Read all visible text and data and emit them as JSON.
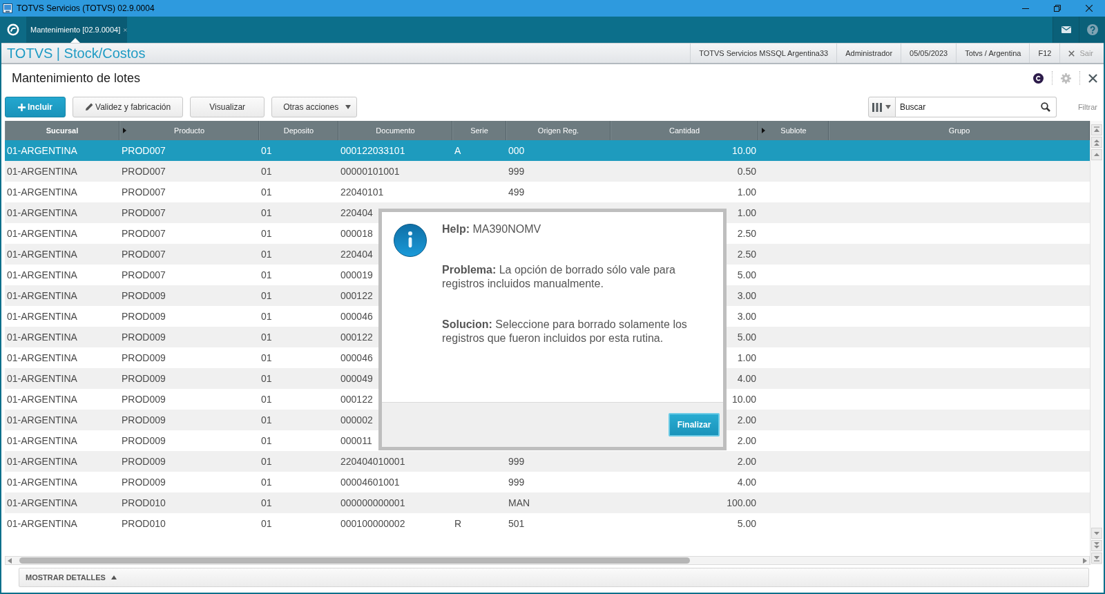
{
  "window": {
    "title": "TOTVS Servicios (TOTVS) 02.9.0004"
  },
  "tabs": [
    {
      "label": "Mantenimiento [02.9.0004]",
      "selected": true
    }
  ],
  "header": {
    "module": "TOTVS | Stock/Costos",
    "session": [
      "TOTVS Servicios MSSQL Argentina33",
      "Administrador",
      "05/05/2023",
      "Totvs / Argentina",
      "F12"
    ],
    "exit": "Sair"
  },
  "page": {
    "title": "Mantenimiento de lotes"
  },
  "toolbar": {
    "buttons": [
      {
        "kind": "primary",
        "label": "Incluir"
      },
      {
        "kind": "edit",
        "label": "Validez y fabricación"
      },
      {
        "kind": "plain",
        "label": "Visualizar"
      },
      {
        "kind": "menu",
        "label": "Otras acciones"
      }
    ]
  },
  "search": {
    "placeholder": "Buscar",
    "filter": "Filtrar"
  },
  "table": {
    "columns": [
      {
        "label": "Sucursal",
        "kind": "text",
        "sorted": true,
        "marker": false
      },
      {
        "label": "Producto",
        "kind": "text",
        "sorted": false,
        "marker": true
      },
      {
        "label": "Deposito",
        "kind": "text",
        "sorted": false,
        "marker": false
      },
      {
        "label": "Documento",
        "kind": "text",
        "sorted": false,
        "marker": false
      },
      {
        "label": "Serie",
        "kind": "text",
        "sorted": false,
        "marker": false
      },
      {
        "label": "Origen Reg.",
        "kind": "text",
        "sorted": false,
        "marker": false
      },
      {
        "label": "Cantidad",
        "kind": "number",
        "sorted": false,
        "marker": false
      },
      {
        "label": "Sublote",
        "kind": "text",
        "sorted": false,
        "marker": true
      },
      {
        "label": "Grupo",
        "kind": "text",
        "sorted": false,
        "marker": false
      }
    ],
    "rows": [
      {
        "selected": true,
        "cells": [
          "01-ARGENTINA",
          "PROD007",
          "01",
          "000122033101",
          "A",
          "000",
          "10.00"
        ]
      },
      {
        "selected": false,
        "cells": [
          "01-ARGENTINA",
          "PROD007",
          "01",
          "00000101001",
          null,
          "999",
          "0.50"
        ]
      },
      {
        "selected": false,
        "cells": [
          "01-ARGENTINA",
          "PROD007",
          "01",
          "22040101",
          null,
          "499",
          "1.00"
        ]
      },
      {
        "selected": false,
        "cells": [
          "01-ARGENTINA",
          "PROD007",
          "01",
          "220404",
          null,
          null,
          "1.00"
        ]
      },
      {
        "selected": false,
        "cells": [
          "01-ARGENTINA",
          "PROD007",
          "01",
          "000018",
          null,
          null,
          "2.50"
        ]
      },
      {
        "selected": false,
        "cells": [
          "01-ARGENTINA",
          "PROD007",
          "01",
          "220404",
          null,
          null,
          "2.50"
        ]
      },
      {
        "selected": false,
        "cells": [
          "01-ARGENTINA",
          "PROD007",
          "01",
          "000019",
          null,
          null,
          "5.00"
        ]
      },
      {
        "selected": false,
        "cells": [
          "01-ARGENTINA",
          "PROD009",
          "01",
          "000122",
          null,
          null,
          "3.00"
        ]
      },
      {
        "selected": false,
        "cells": [
          "01-ARGENTINA",
          "PROD009",
          "01",
          "000046",
          null,
          null,
          "3.00"
        ]
      },
      {
        "selected": false,
        "cells": [
          "01-ARGENTINA",
          "PROD009",
          "01",
          "000122",
          null,
          null,
          "5.00"
        ]
      },
      {
        "selected": false,
        "cells": [
          "01-ARGENTINA",
          "PROD009",
          "01",
          "000046",
          null,
          null,
          "1.00"
        ]
      },
      {
        "selected": false,
        "cells": [
          "01-ARGENTINA",
          "PROD009",
          "01",
          "000049",
          null,
          null,
          "4.00"
        ]
      },
      {
        "selected": false,
        "cells": [
          "01-ARGENTINA",
          "PROD009",
          "01",
          "000122",
          null,
          null,
          "10.00"
        ]
      },
      {
        "selected": false,
        "cells": [
          "01-ARGENTINA",
          "PROD009",
          "01",
          "000002",
          null,
          null,
          "2.00"
        ]
      },
      {
        "selected": false,
        "cells": [
          "01-ARGENTINA",
          "PROD009",
          "01",
          "000011",
          null,
          null,
          "2.00"
        ]
      },
      {
        "selected": false,
        "cells": [
          "01-ARGENTINA",
          "PROD009",
          "01",
          "220404010001",
          null,
          "999",
          "2.00"
        ]
      },
      {
        "selected": false,
        "cells": [
          "01-ARGENTINA",
          "PROD009",
          "01",
          "00004601001",
          null,
          "999",
          "4.00"
        ]
      },
      {
        "selected": false,
        "cells": [
          "01-ARGENTINA",
          "PROD010",
          "01",
          "000000000001",
          null,
          "MAN",
          "100.00"
        ]
      },
      {
        "selected": false,
        "cells": [
          "01-ARGENTINA",
          "PROD010",
          "01",
          "000100000002",
          "R",
          "501",
          "5.00"
        ]
      }
    ]
  },
  "dialog": {
    "kind": "info",
    "paragraphs": [
      "**Help:** MA390NOMV",
      "**Problema:** La opción de borrado sólo vale para registros incluidos manualmente.",
      "**Solucion:** Seleccione para borrado solamente los registros que fueron incluidos por esta rutina."
    ],
    "button": "Finalizar"
  },
  "details": {
    "label": "MOSTRAR DETALLES",
    "expanded": false
  }
}
